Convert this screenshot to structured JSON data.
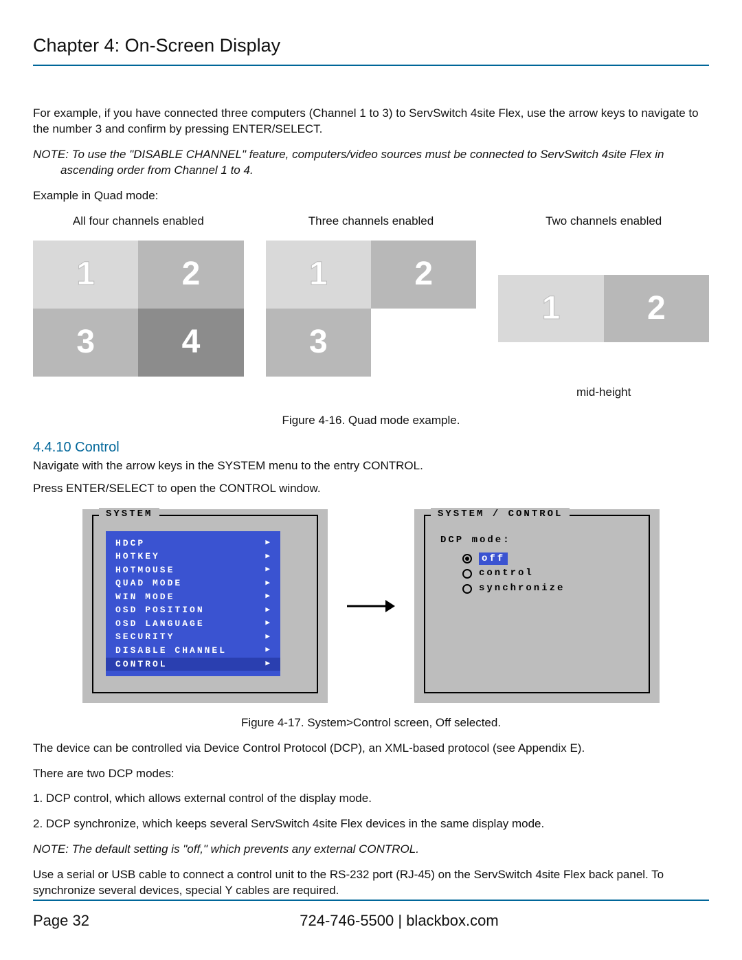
{
  "chapter_title": "Chapter 4: On-Screen Display",
  "p_intro": "For example, if you have connected three computers (Channel 1 to 3) to ServSwitch 4site Flex, use the arrow keys to navigate to the number 3 and confirm by pressing ENTER/SELECT.",
  "note1_a": "NOTE: To use the \"DISABLE CHANNEL\" feature, computers/video sources must be connected to ServSwitch 4site Flex in",
  "note1_b": "ascending order from Channel 1 to 4.",
  "example_mode": "Example in Quad mode:",
  "captions": {
    "c4": "All four channels enabled",
    "c3": "Three channels enabled",
    "c2": "Two channels enabled",
    "midheight": "mid-height"
  },
  "fig16": "Figure 4-16. Quad mode example.",
  "section": "4.4.10 Control",
  "p_nav": "Navigate with the arrow keys in the SYSTEM menu to the entry CONTROL.",
  "p_press": "Press ENTER/SELECT to open the CONTROL window.",
  "win_system_title": "SYSTEM",
  "win_control_title": "SYSTEM / CONTROL",
  "menu": [
    "HDCP",
    "HOTKEY",
    "HOTMOUSE",
    "QUAD MODE",
    "WIN MODE",
    "OSD POSITION",
    "OSD LANGUAGE",
    "SECURITY",
    "DISABLE CHANNEL",
    "CONTROL"
  ],
  "dcp_label": "DCP mode:",
  "dcp_options": {
    "off": "off",
    "control": "control",
    "sync": "synchronize"
  },
  "fig17": "Figure 4-17. System>Control screen, Off selected.",
  "p_dcp": "The device can be controlled via Device Control Protocol (DCP), an XML-based protocol (see Appendix E).",
  "p_two": "There are two DCP modes:",
  "p_li1": "1. DCP control, which allows external control of the display mode.",
  "p_li2": "2. DCP synchronize, which keeps several ServSwitch 4site Flex devices in the same display mode.",
  "note2": "NOTE: The default setting is \"off,\" which prevents any external CONTROL.",
  "p_serial": "Use a serial or USB cable to connect a control unit to the RS-232 port (RJ-45) on the ServSwitch 4site Flex back panel. To synchronize several devices, special Y cables are required.",
  "footer": {
    "page": "Page 32",
    "contact": "724-746-5500   |   blackbox.com"
  }
}
